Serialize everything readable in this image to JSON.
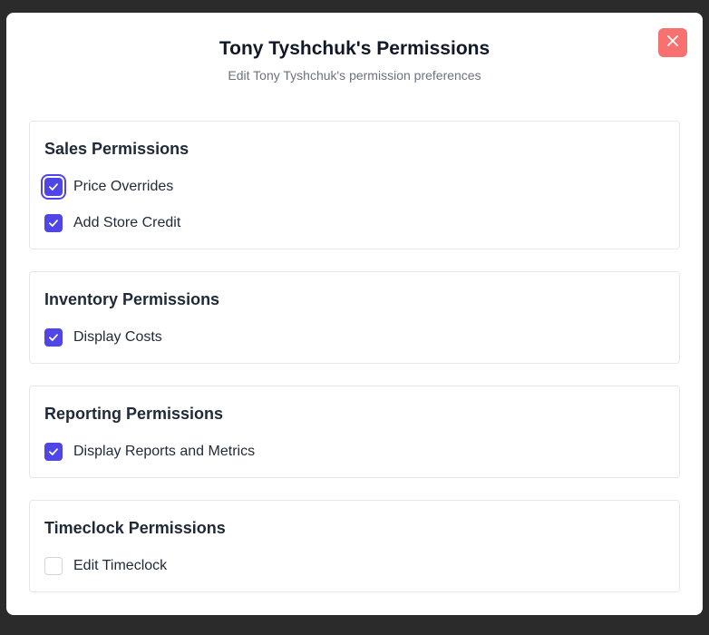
{
  "modal": {
    "title": "Tony Tyshchuk's Permissions",
    "subtitle": "Edit Tony Tyshchuk's permission preferences",
    "close_icon": "close-icon"
  },
  "sections": [
    {
      "title": "Sales Permissions",
      "items": [
        {
          "label": "Price Overrides",
          "checked": true,
          "focused": true
        },
        {
          "label": "Add Store Credit",
          "checked": true
        }
      ]
    },
    {
      "title": "Inventory Permissions",
      "items": [
        {
          "label": "Display Costs",
          "checked": true
        }
      ]
    },
    {
      "title": "Reporting Permissions",
      "items": [
        {
          "label": "Display Reports and Metrics",
          "checked": true
        }
      ]
    },
    {
      "title": "Timeclock Permissions",
      "items": [
        {
          "label": "Edit Timeclock",
          "checked": false
        }
      ]
    }
  ],
  "colors": {
    "accent": "#4f46e5",
    "close_button": "#f87171",
    "backdrop": "#2b2b2b"
  }
}
